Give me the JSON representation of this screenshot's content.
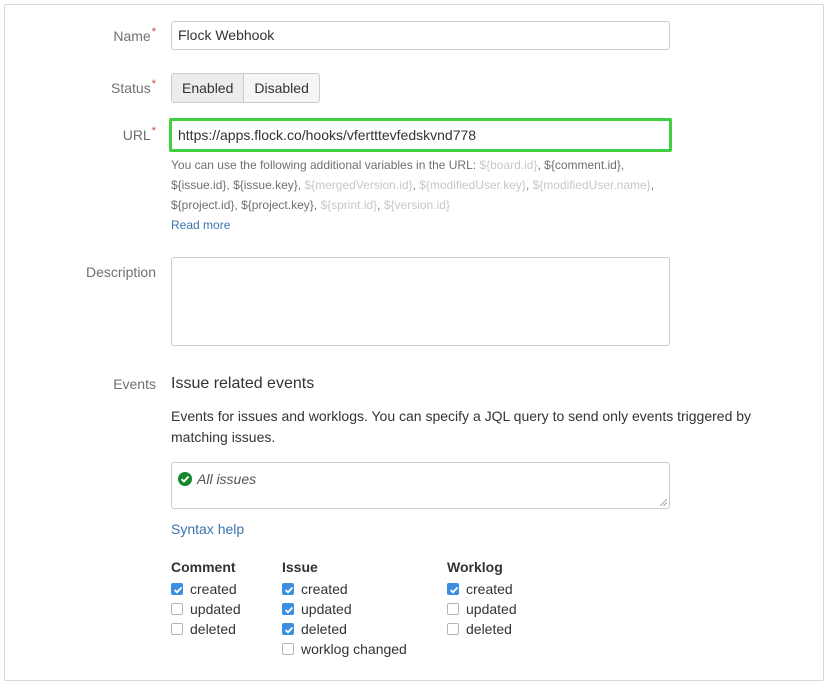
{
  "form": {
    "name": {
      "label": "Name",
      "required_mark": "*",
      "value": "Flock Webhook"
    },
    "status": {
      "label": "Status",
      "required_mark": "*",
      "options": [
        "Enabled",
        "Disabled"
      ],
      "selected": "Enabled"
    },
    "url": {
      "label": "URL",
      "required_mark": "*",
      "value": "https://apps.flock.co/hooks/vfertttevfedskvnd778",
      "help_intro": "You can use the following additional variables in the URL: ",
      "variables": [
        {
          "text": "${board.id}",
          "highlight": false
        },
        {
          "text": "${comment.id}",
          "highlight": true
        },
        {
          "text": "${issue.id}",
          "highlight": true
        },
        {
          "text": "${issue.key}",
          "highlight": true
        },
        {
          "text": "${mergedVersion.id}",
          "highlight": false
        },
        {
          "text": "${modifiedUser.key}",
          "highlight": false
        },
        {
          "text": "${modifiedUser.name}",
          "highlight": false
        },
        {
          "text": "${project.id}",
          "highlight": true
        },
        {
          "text": "${project.key}",
          "highlight": true
        },
        {
          "text": "${sprint.id}",
          "highlight": false
        },
        {
          "text": "${version.id}",
          "highlight": false
        }
      ],
      "read_more": "Read more"
    },
    "description": {
      "label": "Description",
      "value": ""
    },
    "events": {
      "label": "Events",
      "section_title": "Issue related events",
      "section_desc": "Events for issues and worklogs. You can specify a JQL query to send only events triggered by matching issues.",
      "jql_value": "All issues",
      "syntax_help": "Syntax help",
      "groups": [
        {
          "title": "Comment",
          "items": [
            {
              "label": "created",
              "checked": true
            },
            {
              "label": "updated",
              "checked": false
            },
            {
              "label": "deleted",
              "checked": false
            }
          ]
        },
        {
          "title": "Issue",
          "items": [
            {
              "label": "created",
              "checked": true
            },
            {
              "label": "updated",
              "checked": true
            },
            {
              "label": "deleted",
              "checked": true
            },
            {
              "label": "worklog changed",
              "checked": false
            }
          ]
        },
        {
          "title": "Worklog",
          "items": [
            {
              "label": "created",
              "checked": true
            },
            {
              "label": "updated",
              "checked": false
            },
            {
              "label": "deleted",
              "checked": false
            }
          ]
        }
      ]
    }
  },
  "colors": {
    "focus_border": "#3fcf3f",
    "link": "#3b73af",
    "required": "#d04437",
    "checkbox_on": "#3b8ee0",
    "success": "#14892c"
  }
}
